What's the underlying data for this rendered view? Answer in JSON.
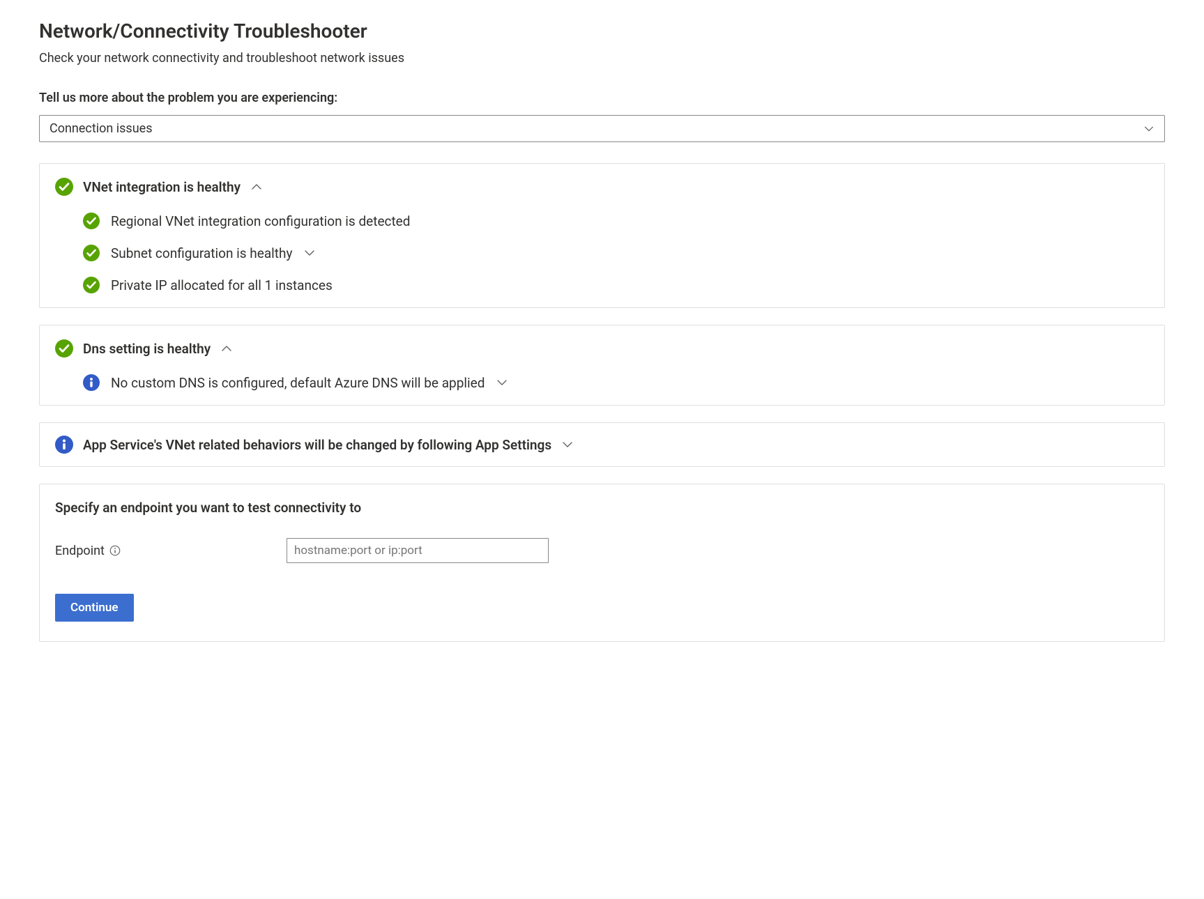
{
  "header": {
    "title": "Network/Connectivity Troubleshooter",
    "subtitle": "Check your network connectivity and troubleshoot network issues"
  },
  "problem": {
    "label": "Tell us more about the problem you are experiencing:",
    "selected": "Connection issues"
  },
  "panels": {
    "vnet": {
      "title": "VNet integration is healthy",
      "items": [
        {
          "text": "Regional VNet integration configuration is detected",
          "expandable": false
        },
        {
          "text": "Subnet configuration is healthy",
          "expandable": true
        },
        {
          "text": "Private IP allocated for all 1 instances",
          "expandable": false
        }
      ]
    },
    "dns": {
      "title": "Dns setting is healthy",
      "items": [
        {
          "text": "No custom DNS is configured, default Azure DNS will be applied",
          "expandable": true
        }
      ]
    },
    "appSettings": {
      "title": "App Service's VNet related behaviors will be changed by following App Settings"
    }
  },
  "endpoint": {
    "title": "Specify an endpoint you want to test connectivity to",
    "label": "Endpoint",
    "placeholder": "hostname:port or ip:port",
    "value": "",
    "button": "Continue"
  },
  "colors": {
    "success": "#57a300",
    "info": "#325bc7",
    "primary_button": "#3b6ecf"
  }
}
